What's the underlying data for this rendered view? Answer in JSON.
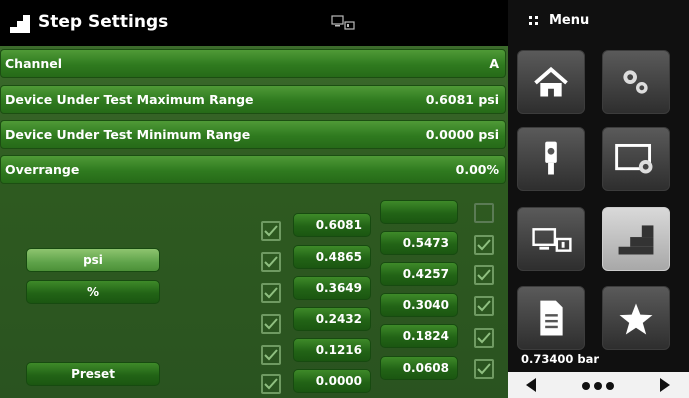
{
  "header": {
    "title": "Step Settings",
    "title_icon": "step-stairs-icon",
    "status_icon": "remote-display-icon"
  },
  "rows": [
    {
      "label": "Channel",
      "value": "A"
    },
    {
      "label": "Device Under Test Maximum Range",
      "value": "0.6081 psi"
    },
    {
      "label": "Device Under Test Minimum Range",
      "value": "0.0000 psi"
    },
    {
      "label": "Overrange",
      "value": "0.00%"
    }
  ],
  "units": {
    "psi": "psi",
    "percent": "%",
    "preset": "Preset"
  },
  "steps_left": [
    "0.6081",
    "0.4865",
    "0.3649",
    "0.2432",
    "0.1216",
    "0.0000"
  ],
  "steps_right": [
    "",
    "0.5473",
    "0.4257",
    "0.3040",
    "0.1824",
    "0.0608"
  ],
  "checkboxes_left": [
    true,
    true,
    true,
    true,
    true,
    true
  ],
  "checkboxes_right": [
    false,
    true,
    true,
    true,
    true,
    true
  ],
  "sidebar": {
    "menu_label": "Menu",
    "tiles": [
      "home-icon",
      "settings-gears-icon",
      "sensor-icon",
      "display-settings-icon",
      "remote-icon",
      "step-icon",
      "document-icon",
      "favorite-star-icon"
    ],
    "barometer": "0.73400  bar"
  },
  "colors": {
    "accent_green": "#2f7a1f",
    "selected_unit": "#5fa34a",
    "sidebar_bg": "#101010"
  }
}
